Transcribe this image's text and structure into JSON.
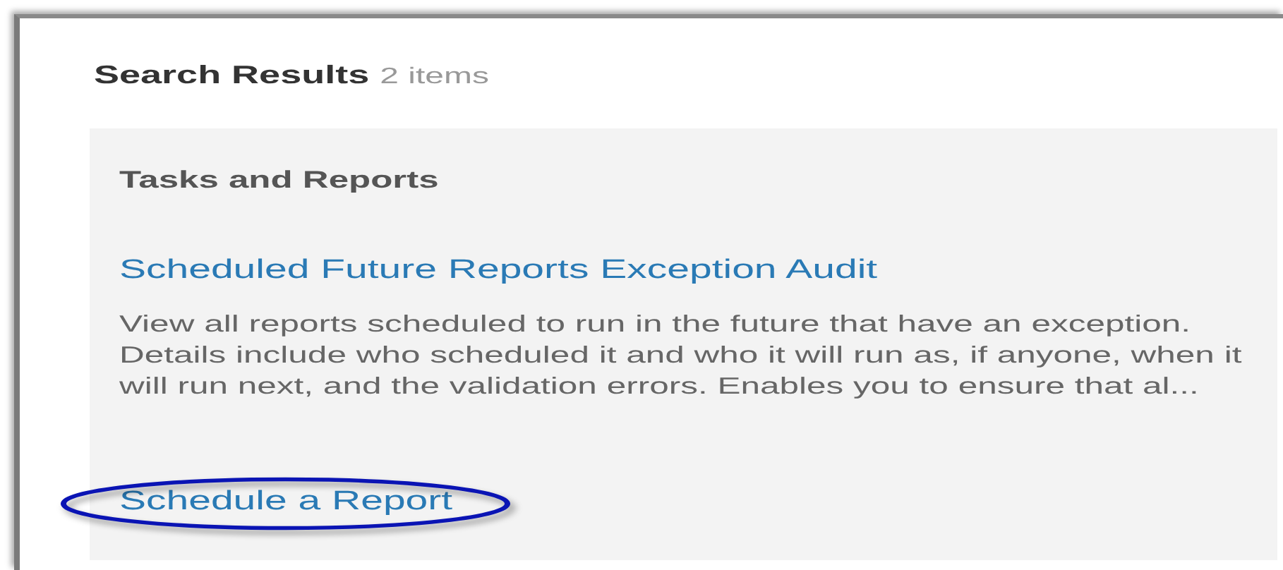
{
  "header": {
    "title": "Search Results",
    "count": "2 items"
  },
  "section": {
    "title": "Tasks and Reports",
    "results": [
      {
        "title": "Scheduled Future Reports Exception Audit",
        "description": "View all reports scheduled to run in the future that have an exception. Details include who scheduled it and who it will run as, if anyone, when it will run next, and the validation errors. Enables you to ensure that al...",
        "highlighted": false
      },
      {
        "title": "Schedule a Report",
        "highlighted": true
      }
    ]
  }
}
